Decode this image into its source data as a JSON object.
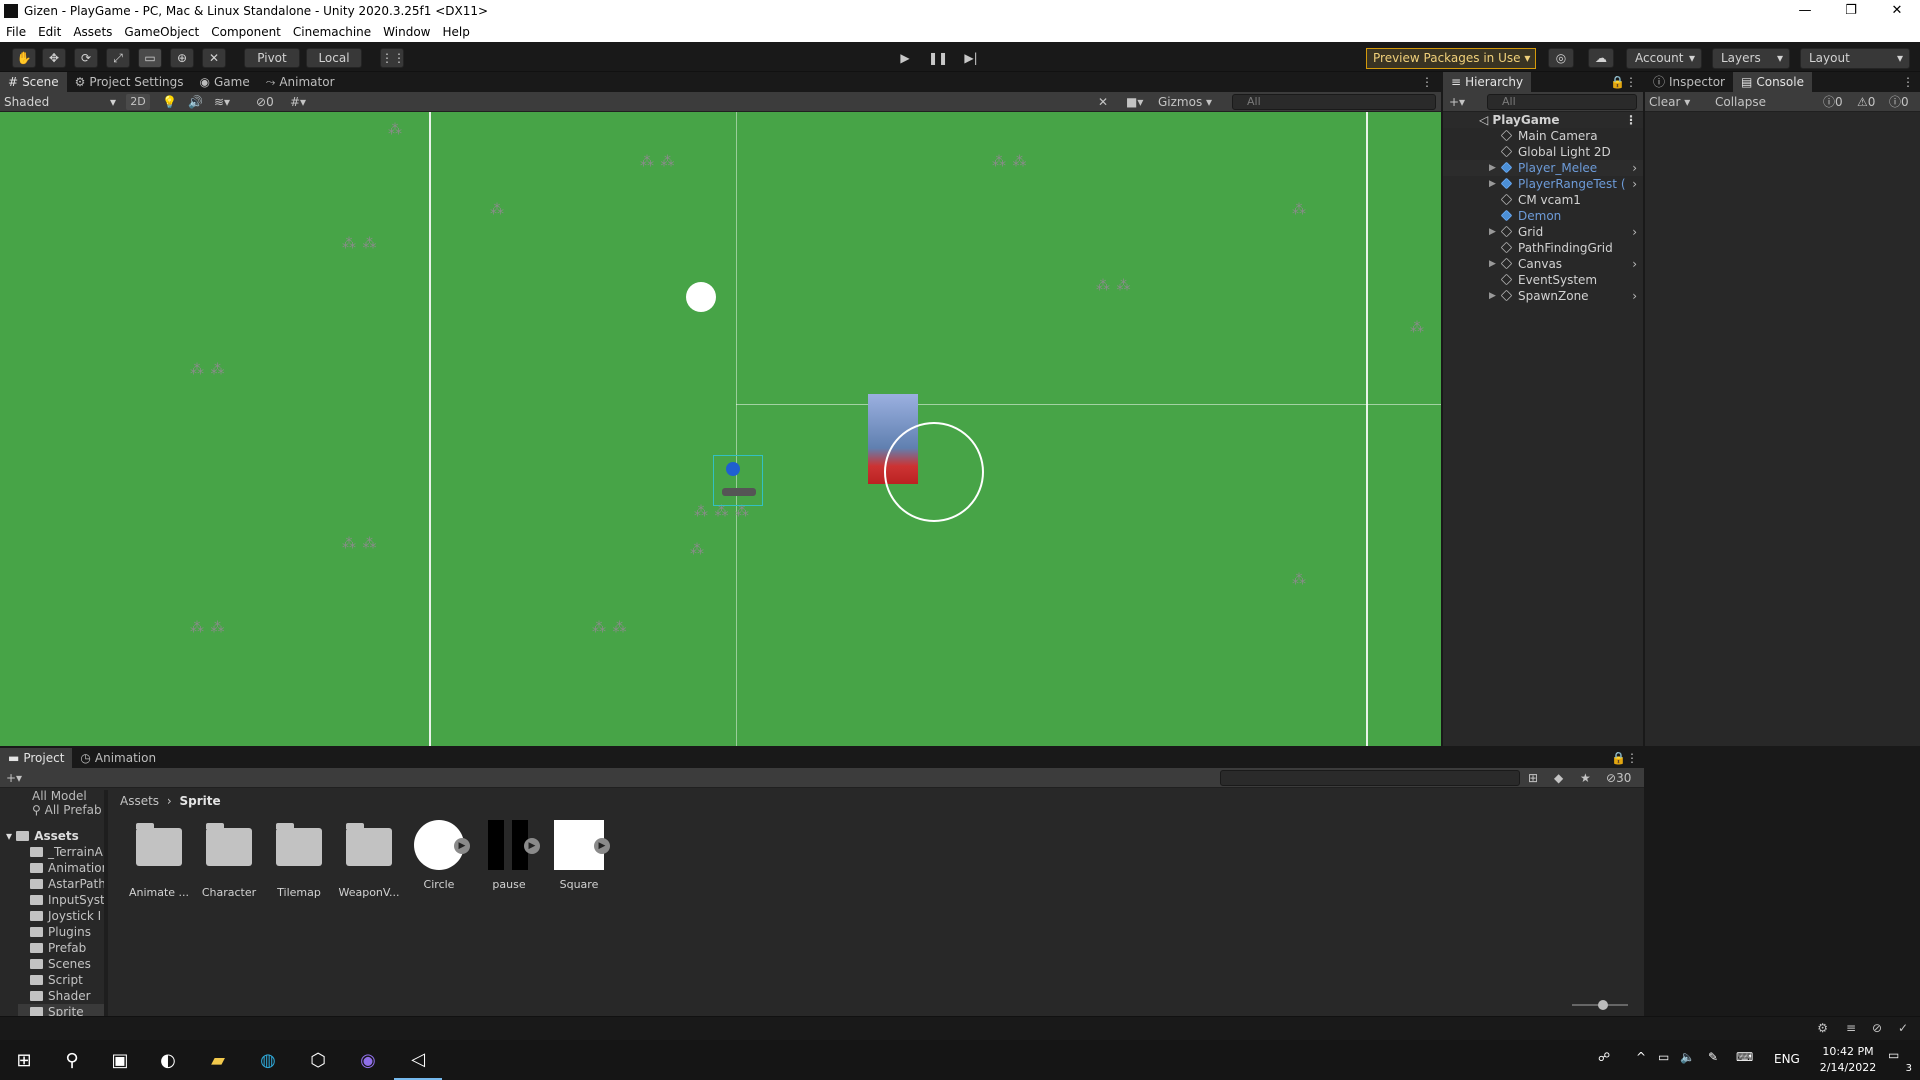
{
  "window": {
    "title": "Gizen - PlayGame - PC, Mac & Linux Standalone - Unity 2020.3.25f1 <DX11>",
    "minimize": "—",
    "maximize": "❐",
    "close": "✕"
  },
  "menu": [
    "File",
    "Edit",
    "Assets",
    "GameObject",
    "Component",
    "Cinemachine",
    "Window",
    "Help"
  ],
  "toolbar": {
    "pivot": "Pivot",
    "local": "Local",
    "preview": "Preview Packages in Use",
    "account": "Account",
    "layers": "Layers",
    "layout": "Layout"
  },
  "scene_tabs": [
    "Scene",
    "Project Settings",
    "Game",
    "Animator"
  ],
  "scene_bar": {
    "shading": "Shaded",
    "mode2d": "2D",
    "hidden_count": "0",
    "gizmos": "Gizmos",
    "search_placeholder": "All"
  },
  "hierarchy": {
    "tab": "Hierarchy",
    "search_placeholder": "All",
    "scene": "PlayGame",
    "items": [
      {
        "label": "Main Camera",
        "blue": false,
        "arrow": false
      },
      {
        "label": "Global Light 2D",
        "blue": false,
        "arrow": false
      },
      {
        "label": "Player_Melee",
        "blue": true,
        "arrow": true
      },
      {
        "label": "PlayerRangeTest (",
        "blue": true,
        "arrow": true
      },
      {
        "label": "CM vcam1",
        "blue": false,
        "arrow": false
      },
      {
        "label": "Demon",
        "blue": true,
        "arrow": false
      },
      {
        "label": "Grid",
        "blue": false,
        "arrow": true
      },
      {
        "label": "PathFindingGrid",
        "blue": false,
        "arrow": false
      },
      {
        "label": "Canvas",
        "blue": false,
        "arrow": true
      },
      {
        "label": "EventSystem",
        "blue": false,
        "arrow": false
      },
      {
        "label": "SpawnZone",
        "blue": false,
        "arrow": true
      }
    ]
  },
  "inspector": {
    "tab_inspector": "Inspector",
    "tab_console": "Console",
    "clear": "Clear",
    "collapse": "Collapse",
    "log_count": "0",
    "warn_count": "0",
    "error_count": "0"
  },
  "project": {
    "tab_project": "Project",
    "tab_animation": "Animation",
    "hidden_count": "30",
    "favorites": [
      "All Model",
      "All Prefab"
    ],
    "assets_root": "Assets",
    "folders": [
      "_TerrainA",
      "Animation",
      "AstarPath",
      "InputSyst",
      "Joystick I",
      "Plugins",
      "Prefab",
      "Scenes",
      "Script",
      "Shader",
      "Sprite"
    ],
    "breadcrumb": [
      "Assets",
      "Sprite"
    ],
    "assets": [
      {
        "label": "Animate ...",
        "kind": "folder"
      },
      {
        "label": "Character",
        "kind": "folder"
      },
      {
        "label": "Tilemap",
        "kind": "folder"
      },
      {
        "label": "WeaponV...",
        "kind": "folder"
      },
      {
        "label": "Circle",
        "kind": "circle"
      },
      {
        "label": "pause",
        "kind": "pause"
      },
      {
        "label": "Square",
        "kind": "square"
      }
    ]
  },
  "taskbar": {
    "language": "ENG",
    "time": "10:42 PM",
    "date": "2/14/2022",
    "notifications": "3"
  }
}
